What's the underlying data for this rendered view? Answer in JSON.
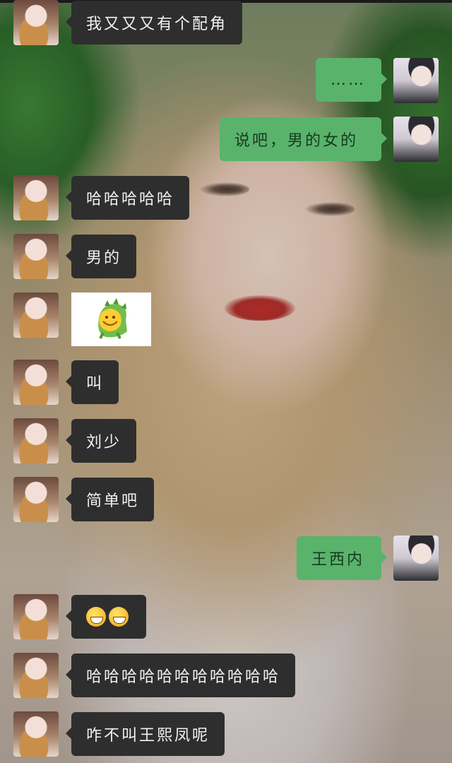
{
  "chat": {
    "messages": [
      {
        "side": "in",
        "text": "我又又又有个配角"
      },
      {
        "side": "out",
        "text": "……"
      },
      {
        "side": "out",
        "text": "说吧，男的女的"
      },
      {
        "side": "in",
        "text": "哈哈哈哈哈"
      },
      {
        "side": "in",
        "text": "男的"
      },
      {
        "side": "in",
        "sticker": "green-dino-smile-sticker"
      },
      {
        "side": "in",
        "text": "叫"
      },
      {
        "side": "in",
        "text": "刘少"
      },
      {
        "side": "in",
        "text": "简单吧"
      },
      {
        "side": "out",
        "text": "王西内"
      },
      {
        "side": "in",
        "emoji": "grinning-face-emoji x2"
      },
      {
        "side": "in",
        "text": "哈哈哈哈哈哈哈哈哈哈哈"
      },
      {
        "side": "in",
        "text": "咋不叫王熙凤呢"
      }
    ]
  },
  "colors": {
    "incoming_bubble": "#2e2e2e",
    "outgoing_bubble": "#59b36b",
    "incoming_text": "#f2f2f2",
    "outgoing_text": "#173a1f"
  }
}
